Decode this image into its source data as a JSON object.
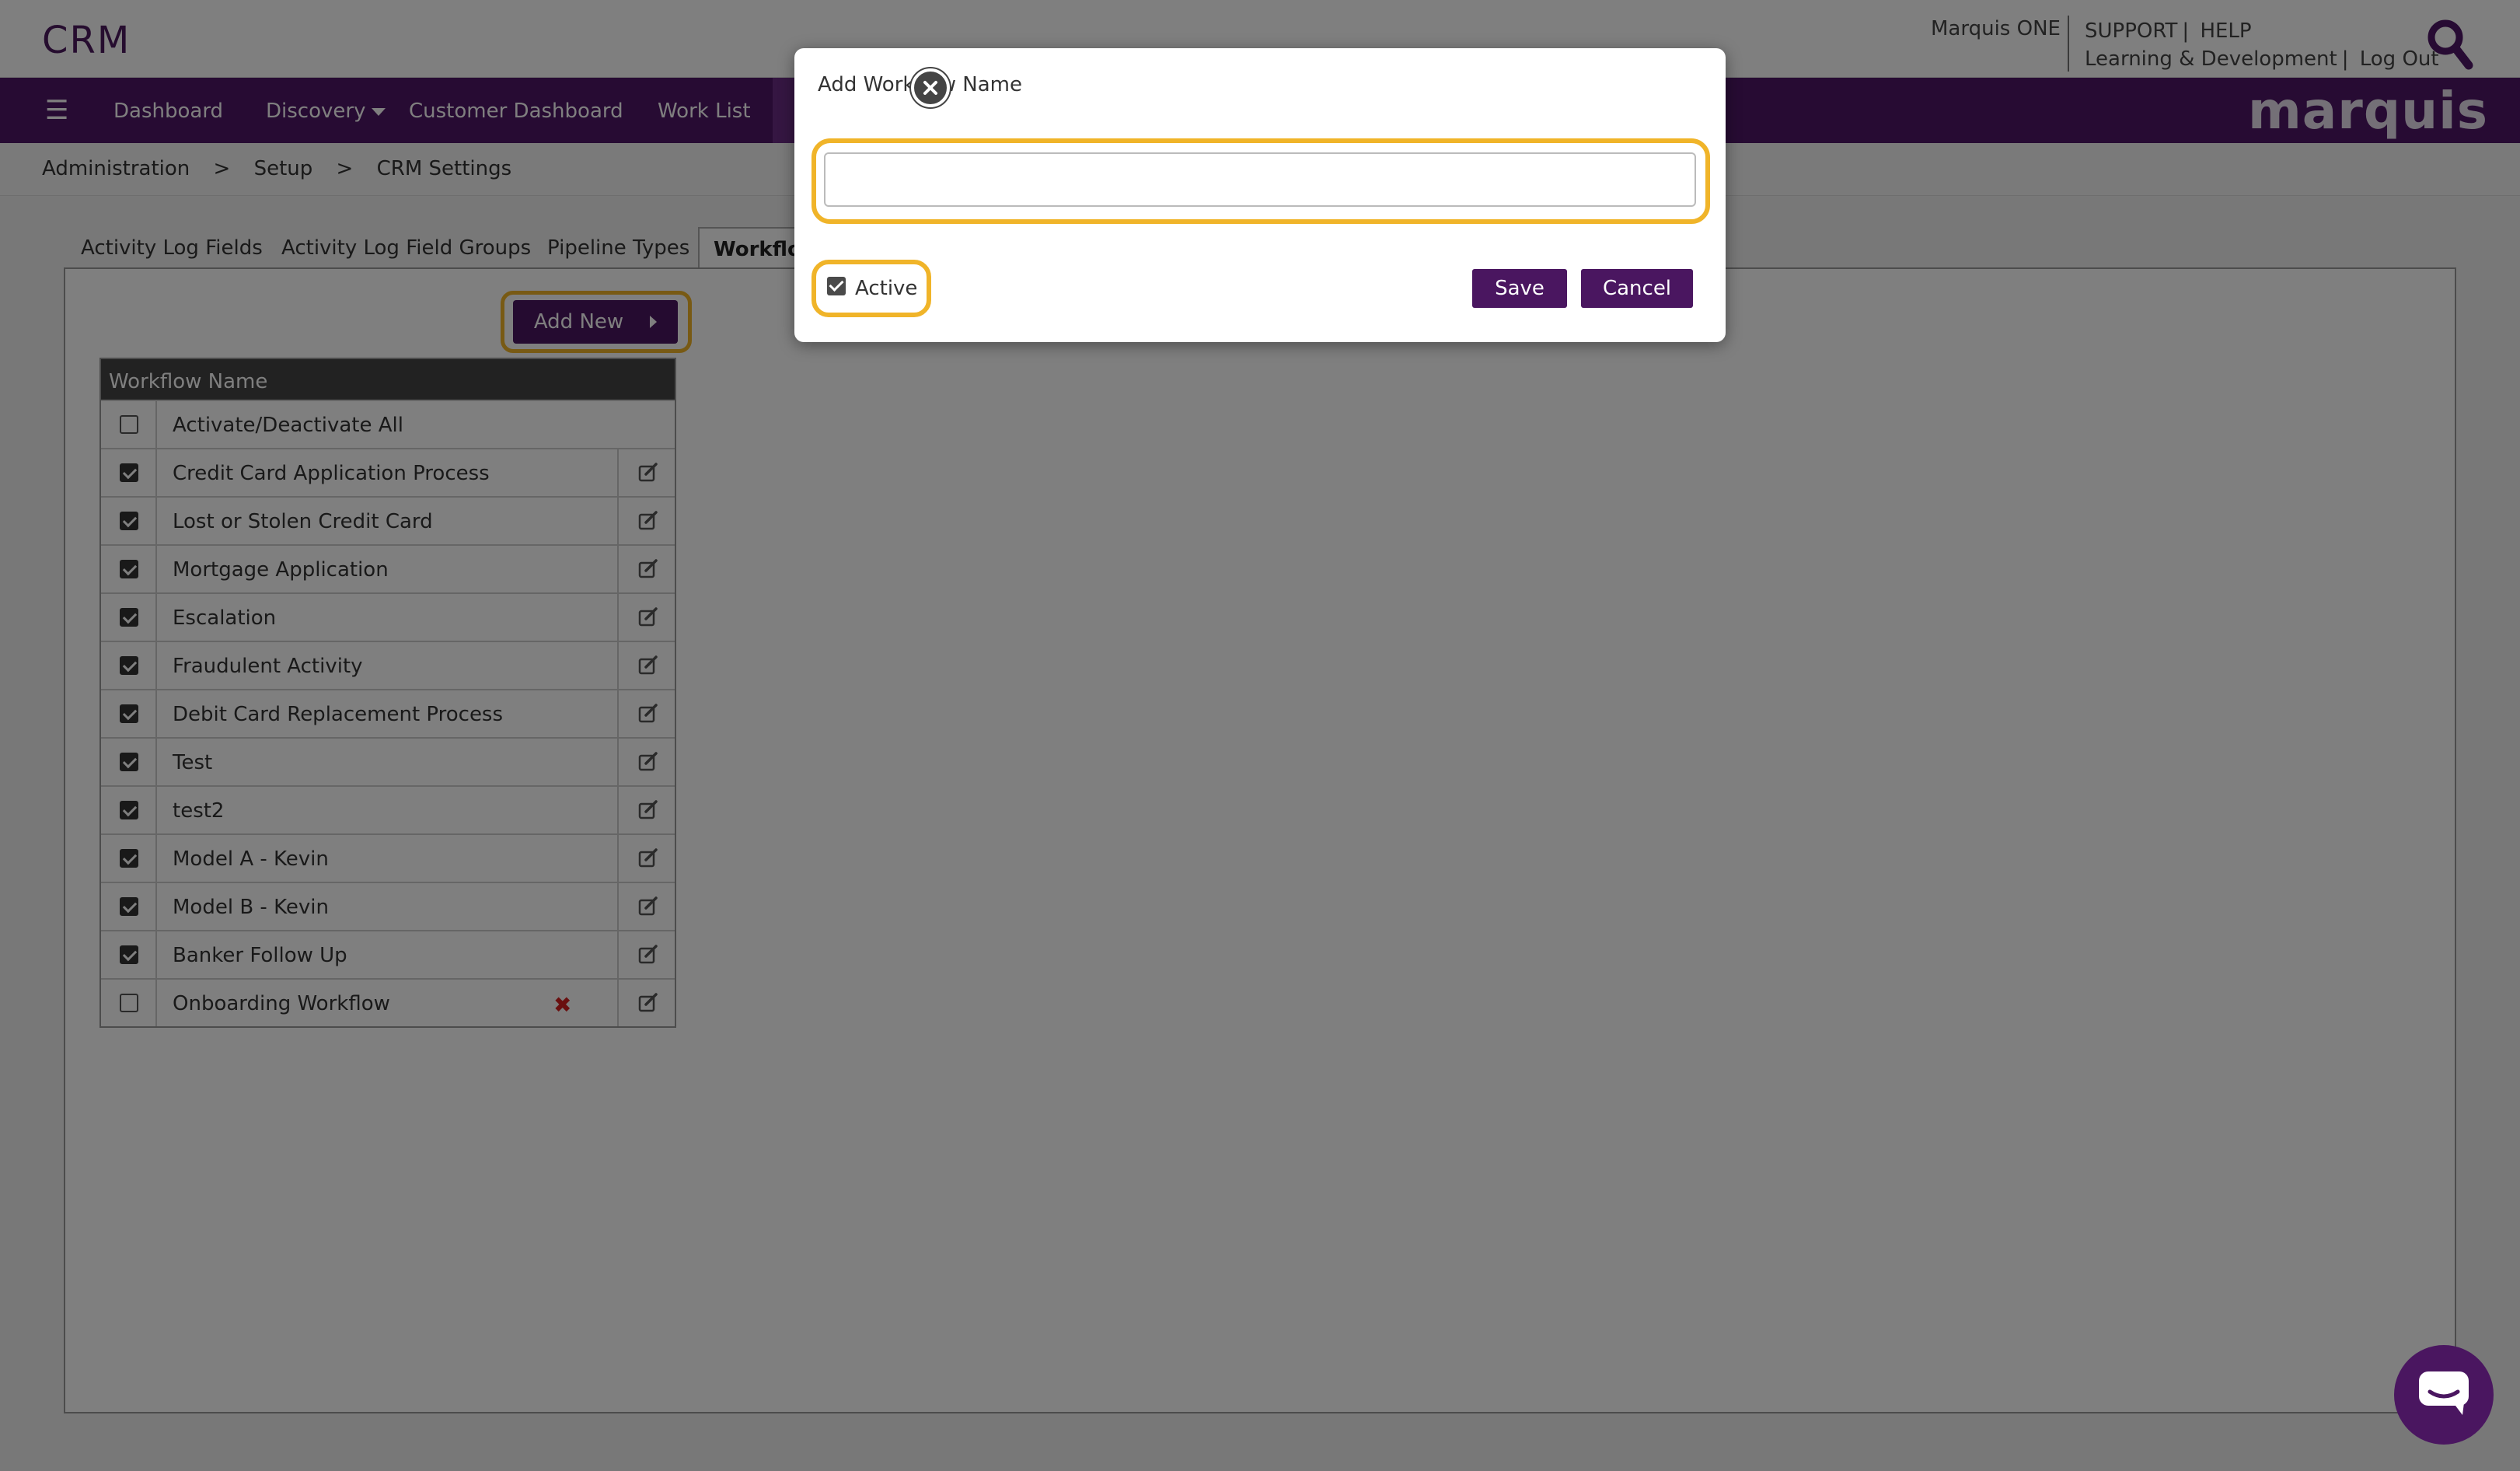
{
  "header": {
    "app_title": "CRM",
    "user_label": "Marquis ONE",
    "links_line1": [
      "SUPPORT",
      "|",
      "HELP"
    ],
    "links_line2": [
      "Learning & Development",
      "|",
      "Log Out"
    ]
  },
  "nav": {
    "items": [
      "Dashboard",
      "Discovery",
      "Customer Dashboard",
      "Work List"
    ],
    "brand": "marquis"
  },
  "breadcrumb": [
    "Administration",
    ">",
    "Setup",
    ">",
    "CRM Settings"
  ],
  "tabs": [
    "Activity Log Fields",
    "Activity Log Field Groups",
    "Pipeline Types",
    "Workflo"
  ],
  "panel": {
    "add_new_label": "Add New",
    "table_header": "Workflow Name",
    "activate_all_label": "Activate/Deactivate All",
    "rows": [
      {
        "name": "Credit Card Application Process",
        "active": true
      },
      {
        "name": "Lost or Stolen Credit Card",
        "active": true
      },
      {
        "name": "Mortgage Application",
        "active": true
      },
      {
        "name": "Escalation",
        "active": true
      },
      {
        "name": "Fraudulent Activity",
        "active": true
      },
      {
        "name": "Debit Card Replacement Process",
        "active": true
      },
      {
        "name": "Test",
        "active": true
      },
      {
        "name": "test2",
        "active": true
      },
      {
        "name": "Model A - Kevin",
        "active": true
      },
      {
        "name": "Model B - Kevin",
        "active": true
      },
      {
        "name": "Banker Follow Up",
        "active": true
      },
      {
        "name": "Onboarding Workflow",
        "active": false
      }
    ]
  },
  "modal": {
    "title": "Add Workflow Name",
    "input_value": "",
    "active_label": "Active",
    "active_checked": true,
    "save_label": "Save",
    "cancel_label": "Cancel"
  },
  "colors": {
    "brand_purple": "#4f1766",
    "button_purple": "#4a1660",
    "focus_ring": "#f0b429",
    "delete_red": "#d42020"
  }
}
